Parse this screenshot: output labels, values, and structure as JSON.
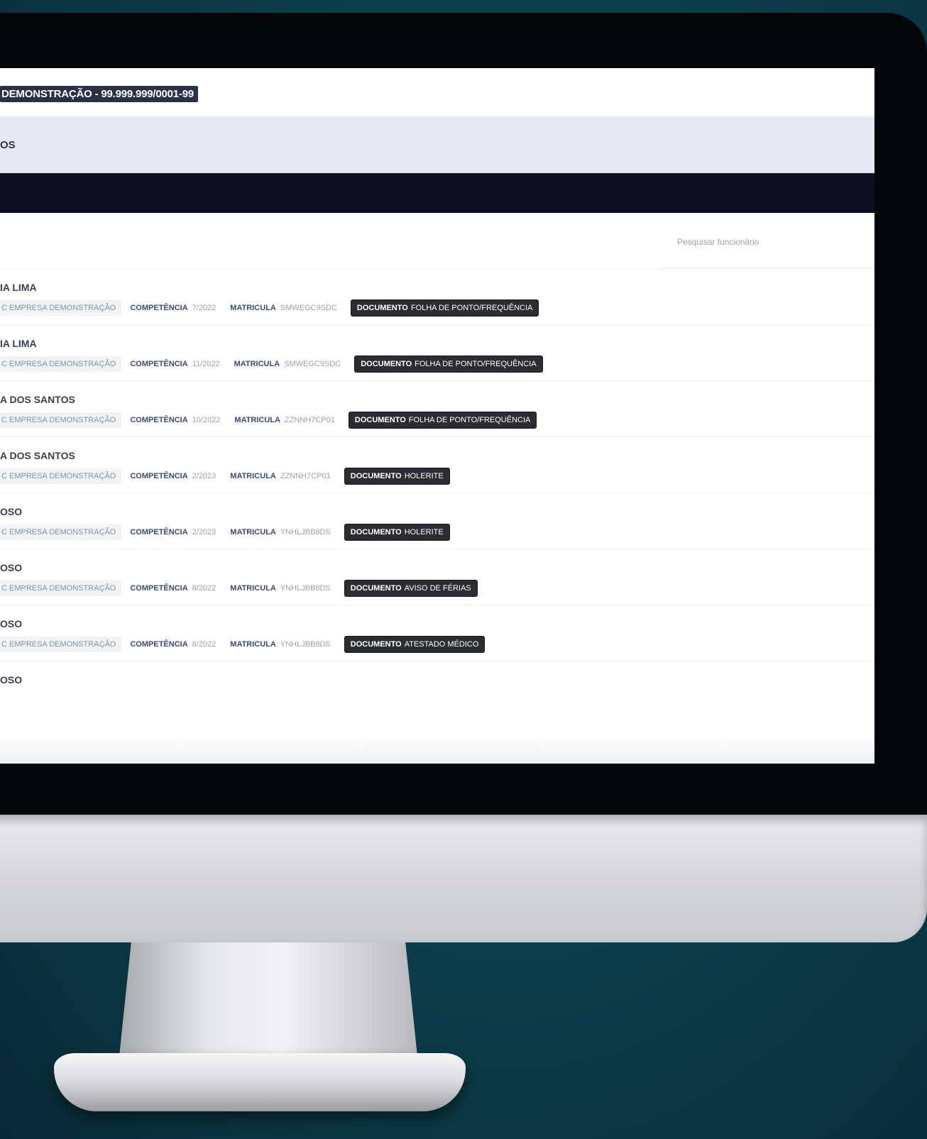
{
  "header": {
    "company": "DEMONSTRAÇÃO - 99.999.999/0001-99"
  },
  "subheader": {
    "title": "OS"
  },
  "search": {
    "placeholder": "Pesquisar funcionário"
  },
  "labels": {
    "competencia": "COMPETÊNCIA",
    "matricula": "MATRICULA",
    "documento": "DOCUMENTO"
  },
  "rows": [
    {
      "name": "IA LIMA",
      "empresa": "C EMPRESA DEMONSTRAÇÃO",
      "competencia": "7/2022",
      "matricula": "SMWEGC9SDC",
      "documento": "FOLHA DE PONTO/FREQUÊNCIA"
    },
    {
      "name": "IA LIMA",
      "empresa": "C EMPRESA DEMONSTRAÇÃO",
      "competencia": "11/2022",
      "matricula": "SMWEGC9SDC",
      "documento": "FOLHA DE PONTO/FREQUÊNCIA"
    },
    {
      "name": "A DOS SANTOS",
      "empresa": "C EMPRESA DEMONSTRAÇÃO",
      "competencia": "10/2022",
      "matricula": "ZZNNH7CP01",
      "documento": "FOLHA DE PONTO/FREQUÊNCIA"
    },
    {
      "name": "A DOS SANTOS",
      "empresa": "C EMPRESA DEMONSTRAÇÃO",
      "competencia": "2/2023",
      "matricula": "ZZNNH7CP01",
      "documento": "HOLERITE"
    },
    {
      "name": "OSO",
      "empresa": "C EMPRESA DEMONSTRAÇÃO",
      "competencia": "2/2023",
      "matricula": "YNHLJBB8DS",
      "documento": "HOLERITE"
    },
    {
      "name": "OSO",
      "empresa": "C EMPRESA DEMONSTRAÇÃO",
      "competencia": "8/2022",
      "matricula": "YNHLJBB8DS",
      "documento": "AVISO DE FÉRIAS"
    },
    {
      "name": "OSO",
      "empresa": "C EMPRESA DEMONSTRAÇÃO",
      "competencia": "8/2022",
      "matricula": "YNHLJBB8DS",
      "documento": "ATESTADO MÉDICO"
    },
    {
      "name": "OSO"
    }
  ]
}
